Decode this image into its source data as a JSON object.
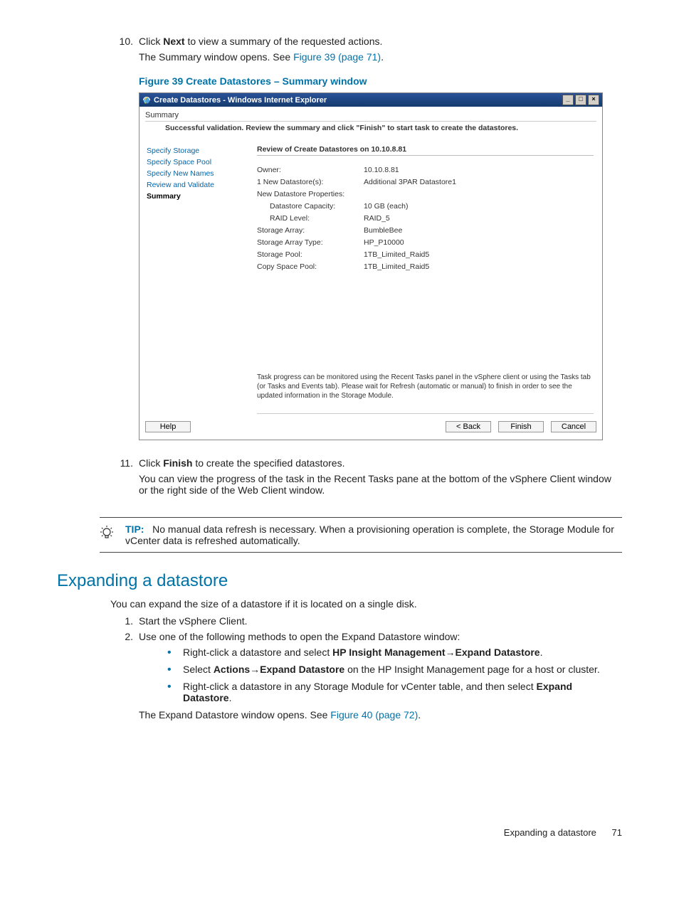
{
  "step10": {
    "num": "10.",
    "line1a": "Click ",
    "line1b": "Next",
    "line1c": " to view a summary of the requested actions.",
    "line2a": "The Summary window opens. See ",
    "line2link": "Figure 39 (page 71)",
    "line2b": "."
  },
  "figure39caption": "Figure 39 Create Datastores – Summary window",
  "win": {
    "title": "Create Datastores - Windows Internet Explorer",
    "subtitle": "Summary",
    "desc": "Successful validation. Review the summary and click \"Finish\" to start task to create the datastores.",
    "nav": [
      "Specify Storage",
      "Specify Space Pool",
      "Specify New Names",
      "Review and Validate",
      "Summary"
    ],
    "reviewTitle": "Review of Create Datastores on 10.10.8.81",
    "rows": [
      {
        "k": "Owner:",
        "v": "10.10.8.81",
        "sub": false
      },
      {
        "k": "1 New Datastore(s):",
        "v": "Additional 3PAR Datastore1",
        "sub": false
      },
      {
        "k": "New Datastore Properties:",
        "v": "",
        "sub": false
      },
      {
        "k": "Datastore Capacity:",
        "v": "10 GB (each)",
        "sub": true
      },
      {
        "k": "RAID Level:",
        "v": "RAID_5",
        "sub": true
      },
      {
        "k": "Storage Array:",
        "v": "BumbleBee",
        "sub": false
      },
      {
        "k": "Storage Array Type:",
        "v": "HP_P10000",
        "sub": false
      },
      {
        "k": "Storage Pool:",
        "v": "1TB_Limited_Raid5",
        "sub": false
      },
      {
        "k": "Copy Space Pool:",
        "v": "1TB_Limited_Raid5",
        "sub": false
      }
    ],
    "note": "Task progress can be monitored using the Recent Tasks panel in the vSphere client or using the Tasks tab (or Tasks and Events tab). Please wait for Refresh (automatic or manual) to finish in order to see the updated information in the Storage Module.",
    "btnHelp": "Help",
    "btnBack": "< Back",
    "btnFinish": "Finish",
    "btnCancel": "Cancel"
  },
  "step11": {
    "num": "11.",
    "line1a": "Click ",
    "line1b": "Finish",
    "line1c": " to create the specified datastores.",
    "line2": "You can view the progress of the task in the Recent Tasks pane at the bottom of the vSphere Client window or the right side of the Web Client window."
  },
  "tip": {
    "label": "TIP:",
    "text": "No manual data refresh is necessary. When a provisioning operation is complete, the Storage Module for vCenter data is refreshed automatically."
  },
  "sectionHeading": "Expanding a datastore",
  "expandIntro": "You can expand the size of a datastore if it is located on a single disk.",
  "expandStep1": {
    "num": "1.",
    "text": "Start the vSphere Client."
  },
  "expandStep2": {
    "num": "2.",
    "text": "Use one of the following methods to open the Expand Datastore window:"
  },
  "bullets": {
    "b1a": "Right-click a datastore and select ",
    "b1b": "HP Insight Management",
    "b1c": "→",
    "b1d": "Expand Datastore",
    "b1e": ".",
    "b2a": "Select ",
    "b2b": "Actions",
    "b2c": "→",
    "b2d": "Expand Datastore",
    "b2e": " on the HP Insight Management page for a host or cluster.",
    "b3a": "Right-click a datastore in any Storage Module for vCenter table, and then select ",
    "b3b": "Expand Datastore",
    "b3c": "."
  },
  "expandOpens": {
    "a": "The Expand Datastore window opens. See ",
    "link": "Figure 40 (page 72)",
    "b": "."
  },
  "footer": {
    "text": "Expanding a datastore",
    "page": "71"
  }
}
